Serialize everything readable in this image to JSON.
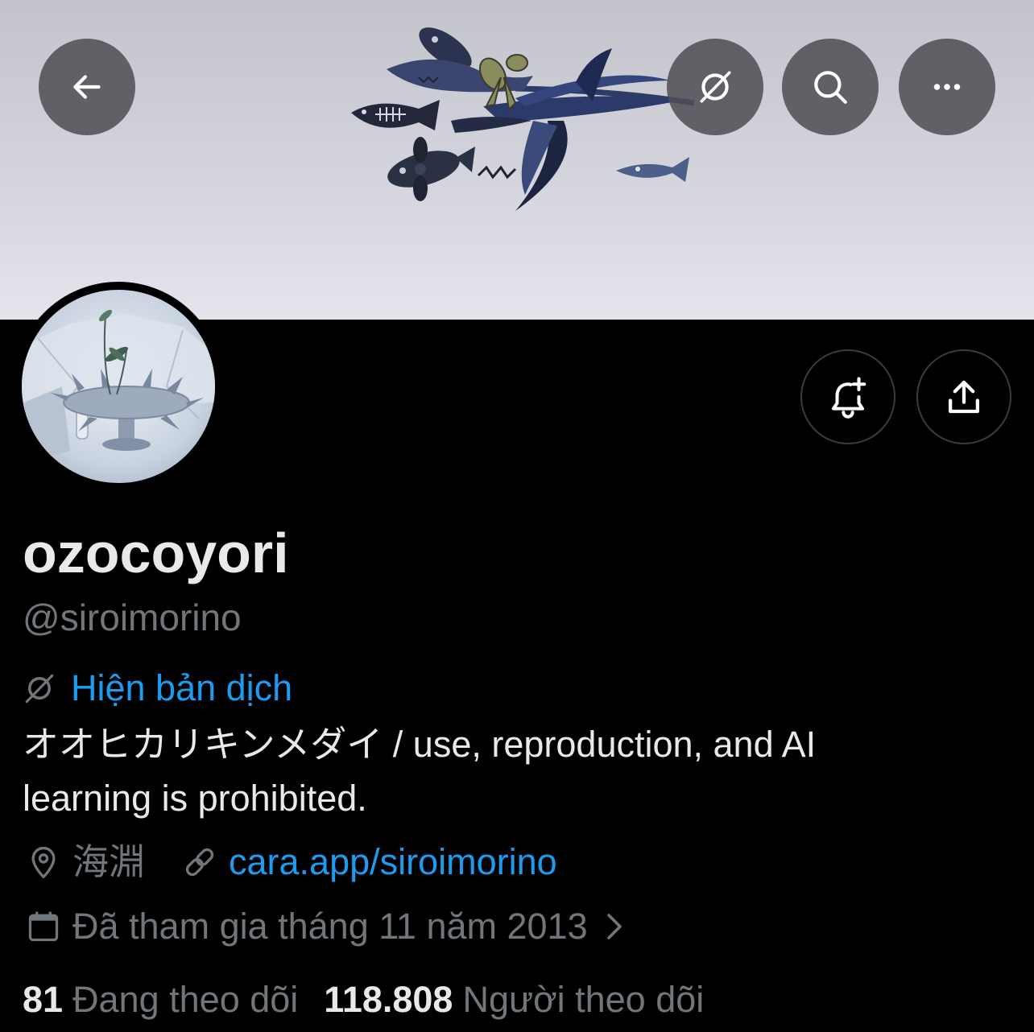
{
  "header": {
    "back_icon": "arrow-left-icon",
    "grok_icon": "grok-icon",
    "search_icon": "search-icon",
    "more_icon": "more-horizontal-icon"
  },
  "profile": {
    "display_name": "ozocoyori",
    "handle": "@siroimorino",
    "translate_label": "Hiện bản dịch",
    "bio_lines": [
      "オオヒカリキンメダイ / use, reproduction, and AI",
      "learning is prohibited."
    ],
    "location": "海淵",
    "website": "cara.app/siroimorino",
    "joined": "Đã tham gia tháng 11 năm 2013",
    "following_count": "81",
    "following_label": "Đang theo dõi",
    "followers_count": "118.808",
    "followers_label": "Người theo dõi"
  },
  "actions": {
    "notify_icon": "bell-plus-icon",
    "share_icon": "share-icon"
  },
  "icons": {
    "location": "map-pin-icon",
    "website": "link-icon",
    "joined": "calendar-icon",
    "joined_chevron": "chevron-right-icon"
  },
  "colors": {
    "background": "#000000",
    "primary_text": "#e7e9ea",
    "secondary_text": "#71767b",
    "link": "#1d9bf0",
    "banner_top": "#c3c4cb",
    "banner_bottom": "#e4e4ec"
  }
}
